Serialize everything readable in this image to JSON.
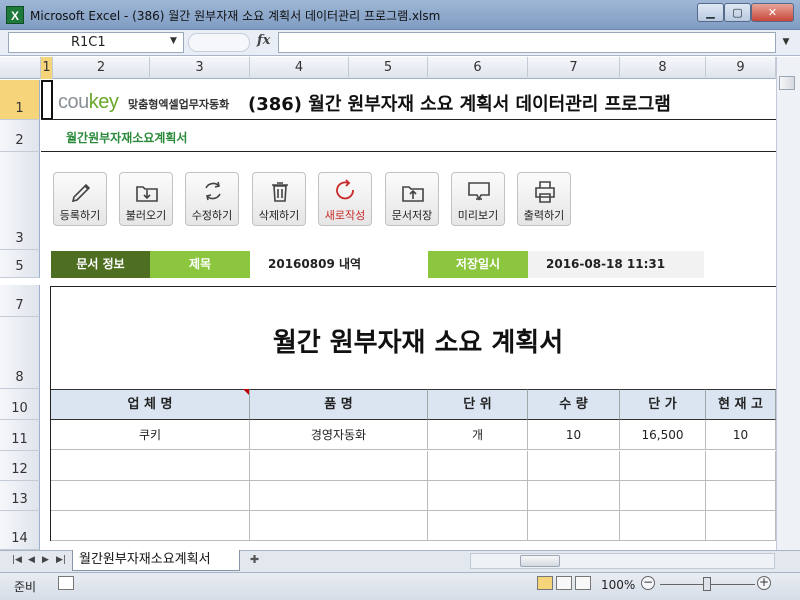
{
  "window": {
    "app_icon": "X",
    "title": "Microsoft Excel - (386) 월간 원부자재 소요 계획서 데이터관리 프로그램.xlsm",
    "minimize_icon": "▁",
    "maximize_icon": "▢",
    "close_icon": "✕"
  },
  "formula_bar": {
    "name_box": "R1C1",
    "fx_label": "fx",
    "formula": ""
  },
  "columns": [
    "1",
    "2",
    "3",
    "4",
    "5",
    "6",
    "7",
    "8",
    "9"
  ],
  "rows": [
    "1",
    "2",
    "3",
    "5",
    "7",
    "8",
    "10",
    "11",
    "12",
    "13",
    "14"
  ],
  "header": {
    "logo_cou": "cou",
    "logo_key": "key",
    "logo_tagline": "맞춤형엑셀업무자동화",
    "title": "(386) 월간 원부자재 소요 계획서 데이터관리 프로그램",
    "subtitle": "월간원부자재소요계획서"
  },
  "toolbar": [
    {
      "label": "등록하기",
      "icon": "pencil-icon"
    },
    {
      "label": "불러오기",
      "icon": "download-icon"
    },
    {
      "label": "수정하기",
      "icon": "refresh-icon"
    },
    {
      "label": "삭제하기",
      "icon": "trash-icon"
    },
    {
      "label": "새로작성",
      "icon": "new-icon"
    },
    {
      "label": "문서저장",
      "icon": "folder-upload-icon"
    },
    {
      "label": "미리보기",
      "icon": "monitor-icon"
    },
    {
      "label": "출력하기",
      "icon": "printer-icon"
    }
  ],
  "info": {
    "doc_info_label": "문서 정보",
    "title_label": "제목",
    "title_value": "20160809 내역",
    "saved_label": "저장일시",
    "saved_value": "2016-08-18 11:31"
  },
  "document": {
    "title": "월간 원부자재 소요 계획서",
    "headers": [
      "업 체 명",
      "품   명",
      "단 위",
      "수 량",
      "단 가",
      "현 재 고"
    ],
    "rows": [
      [
        "쿠키",
        "경영자동화",
        "개",
        "10",
        "16,500",
        "10"
      ],
      [
        "",
        "",
        "",
        "",
        "",
        ""
      ],
      [
        "",
        "",
        "",
        "",
        "",
        ""
      ],
      [
        "",
        "",
        "",
        "",
        "",
        ""
      ]
    ]
  },
  "sheet_tabs": {
    "active": "월간원부자재소요계획서"
  },
  "status": {
    "text": "준비",
    "zoom": "100%"
  },
  "colors": {
    "doc_info": "#4e6e21",
    "label_green": "#8cc63f",
    "subtitle_green": "#2a8a3a",
    "table_header": "#dbe5f1"
  }
}
